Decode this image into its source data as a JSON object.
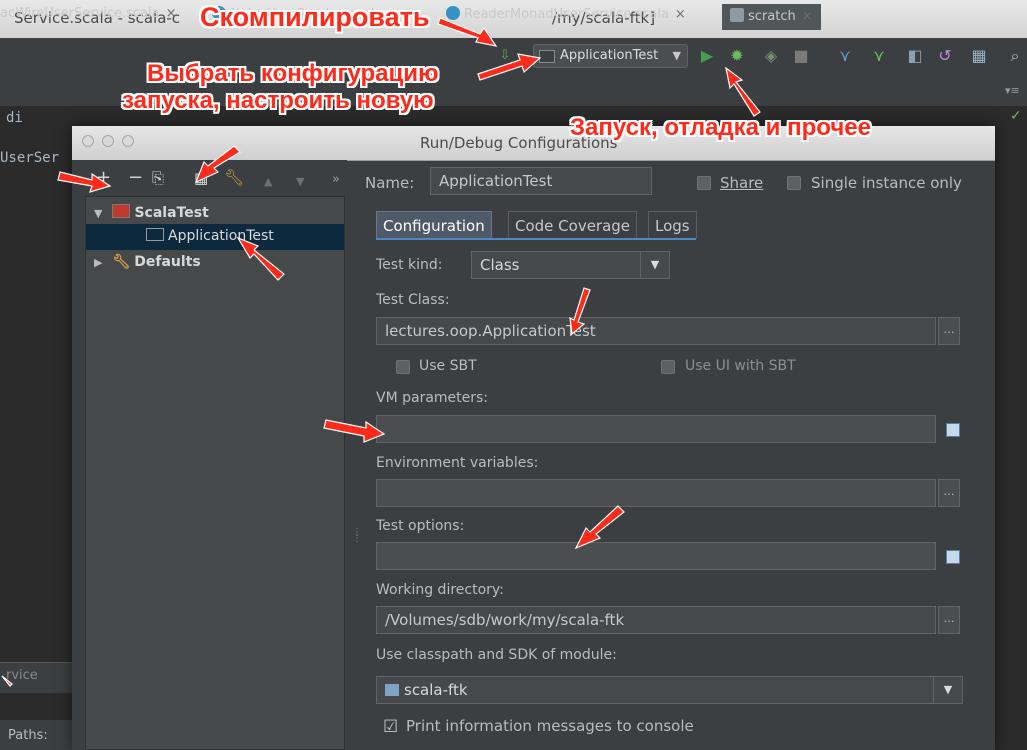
{
  "ide": {
    "title_left": "Service.scala - scala-c",
    "title_right": "/my/scala-ftk]",
    "editor_tabs": [
      {
        "label": "acWireUserService.scala"
      },
      {
        "label": "NaiveUserService.scala"
      },
      {
        "label": "ReaderMonadUserService.scala"
      },
      {
        "label": "scratch"
      }
    ],
    "editor_line1": "di",
    "editor_line2": "UserSer",
    "bottom_tool": "rvice",
    "status_text": "Paths:",
    "run_config": "ApplicationTest"
  },
  "dialog": {
    "title": "Run/Debug Configurations",
    "tree": {
      "group": "ScalaTest",
      "item": "ApplicationTest",
      "defaults": "Defaults"
    },
    "name_label": "Name:",
    "name_value": "ApplicationTest",
    "share_label": "Share",
    "single_instance_label": "Single instance only",
    "tabs": [
      "Configuration",
      "Code Coverage",
      "Logs"
    ],
    "test_kind_label": "Test kind:",
    "test_kind_value": "Class",
    "test_class_label": "Test Class:",
    "test_class_value": "lectures.oop.ApplicationTest",
    "use_sbt_label": "Use SBT",
    "use_ui_sbt_label": "Use UI with SBT",
    "vm_params_label": "VM parameters:",
    "vm_params_value": "",
    "env_vars_label": "Environment variables:",
    "env_vars_value": "",
    "test_options_label": "Test options:",
    "test_options_value": "",
    "working_dir_label": "Working directory:",
    "working_dir_value": "/Volumes/sdb/work/my/scala-ftk",
    "module_label": "Use classpath and SDK of module:",
    "module_value": "scala-ftk",
    "print_info_label": "Print information messages to console",
    "print_info_checked": true
  },
  "annotations": {
    "compile": "Скомпилировать",
    "choose_config_line1": "Выбрать конфигурацию",
    "choose_config_line2": "запуска, настроить новую",
    "run_debug": "Запуск, отладка и прочее"
  },
  "colors": {
    "annotation": "#ff2a1a",
    "selection": "#0d293e",
    "run_green": "#499c54"
  }
}
